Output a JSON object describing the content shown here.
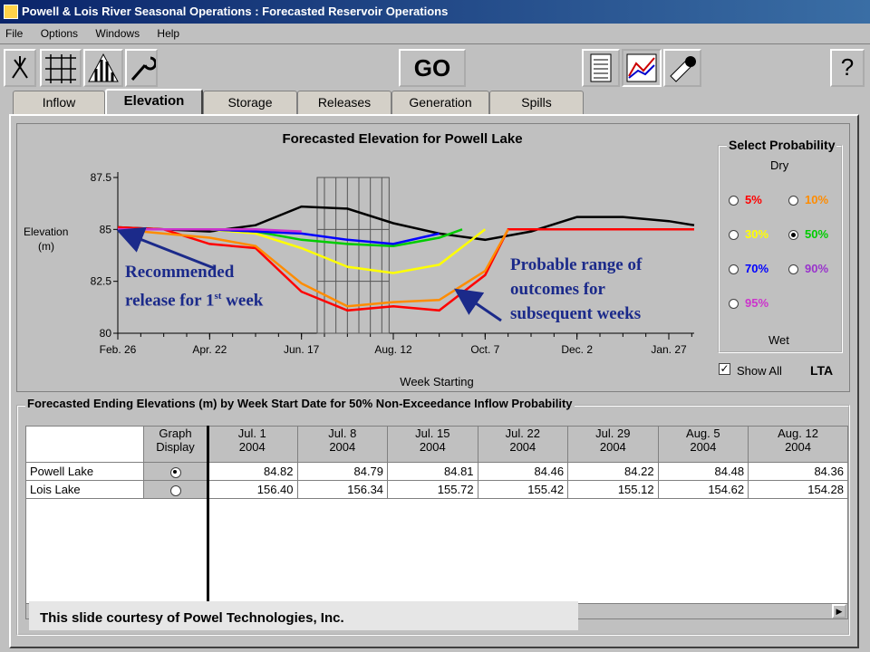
{
  "window": {
    "title": "Powell & Lois River Seasonal Operations : Forecasted Reservoir Operations"
  },
  "menu": [
    "File",
    "Options",
    "Windows",
    "Help"
  ],
  "toolbar": {
    "left_icons": [
      "y-branch-icon",
      "grid-rule-icon",
      "histogram-icon",
      "wrench-icon"
    ],
    "go_label": "GO",
    "right_icons": [
      "report-sheet-icon",
      "xy-chart-icon",
      "tools-icon"
    ],
    "help_label": "?"
  },
  "tabs": [
    "Inflow",
    "Elevation",
    "Storage",
    "Releases",
    "Generation",
    "Spills"
  ],
  "active_tab": "Elevation",
  "chart": {
    "title": "Forecasted Elevation for Powell Lake",
    "ylabel_line1": "Elevation",
    "ylabel_line2": "(m)",
    "xlabel": "Week Starting",
    "y_ticks": [
      "87.5",
      "85",
      "82.5",
      "80"
    ],
    "x_ticks": [
      "Feb. 26",
      "Apr. 22",
      "Jun. 17",
      "Aug. 12",
      "Oct. 7",
      "Dec. 2",
      "Jan. 27"
    ]
  },
  "chart_data": {
    "type": "line",
    "title": "Forecasted Elevation for Powell Lake",
    "xlabel": "Week Starting",
    "ylabel": "Elevation (m)",
    "x_tick_labels": [
      "Feb. 26",
      "Apr. 22",
      "Jun. 17",
      "Aug. 12",
      "Oct. 7",
      "Dec. 2",
      "Jan. 27"
    ],
    "ylim": [
      80,
      87.5
    ],
    "grid": false,
    "legend": "right panel (Select Probability)",
    "series": [
      {
        "name": "LTA",
        "color": "#000000",
        "x": [
          "Feb. 26",
          "Mar. 25",
          "Apr. 22",
          "May 20",
          "Jun. 17",
          "Jul. 15",
          "Aug. 12",
          "Sep. 9",
          "Oct. 7",
          "Nov. 4",
          "Dec. 2",
          "Dec. 30",
          "Jan. 27",
          "Feb. 24"
        ],
        "y": [
          85.1,
          85.0,
          84.9,
          85.2,
          86.1,
          86.0,
          85.3,
          84.8,
          84.5,
          84.9,
          85.6,
          85.6,
          85.4,
          85.2
        ]
      },
      {
        "name": "5%",
        "color": "#ff0000",
        "x": [
          "Feb. 26",
          "Mar. 25",
          "Apr. 22",
          "May 20",
          "Jun. 17",
          "Jul. 15",
          "Aug. 12",
          "Sep. 9",
          "Oct. 7",
          "Oct. 21",
          "Dec. 2",
          "Feb. 24"
        ],
        "y": [
          85.1,
          85.0,
          84.3,
          84.1,
          82.0,
          81.1,
          81.3,
          81.1,
          82.8,
          85.0,
          85.0,
          85.0
        ]
      },
      {
        "name": "10%",
        "color": "#ff8c00",
        "x": [
          "Feb. 26",
          "Apr. 22",
          "May 20",
          "Jun. 17",
          "Jul. 15",
          "Aug. 12",
          "Sep. 9",
          "Oct. 7",
          "Oct. 21"
        ],
        "y": [
          85.0,
          84.6,
          84.2,
          82.4,
          81.3,
          81.5,
          81.6,
          83.0,
          85.0
        ]
      },
      {
        "name": "30%",
        "color": "#ffff00",
        "x": [
          "Feb. 26",
          "Apr. 22",
          "May 20",
          "Jun. 17",
          "Jul. 15",
          "Aug. 12",
          "Sep. 9",
          "Oct. 7"
        ],
        "y": [
          85.0,
          85.0,
          84.8,
          84.1,
          83.2,
          82.9,
          83.3,
          85.0
        ]
      },
      {
        "name": "50%",
        "color": "#00cc00",
        "x": [
          "Feb. 26",
          "Apr. 22",
          "May 20",
          "Jun. 17",
          "Jul. 15",
          "Aug. 12",
          "Sep. 9",
          "Sep. 23"
        ],
        "y": [
          85.0,
          85.0,
          84.9,
          84.5,
          84.3,
          84.2,
          84.6,
          85.0
        ]
      },
      {
        "name": "70%",
        "color": "#0000ff",
        "x": [
          "Feb. 26",
          "Apr. 22",
          "May 20",
          "Jun. 17",
          "Jul. 15",
          "Aug. 12",
          "Sep. 9"
        ],
        "y": [
          85.0,
          85.0,
          84.9,
          84.8,
          84.5,
          84.3,
          84.8
        ]
      },
      {
        "name": "95%",
        "color": "#cc33cc",
        "x": [
          "Feb. 26",
          "Apr. 22",
          "May 20",
          "Jun. 17"
        ],
        "y": [
          85.0,
          85.0,
          85.0,
          84.9
        ]
      }
    ],
    "highlight_weeks": [
      "Jul. 1",
      "Jul. 8",
      "Jul. 15",
      "Jul. 22",
      "Jul. 29",
      "Aug. 5"
    ]
  },
  "probability": {
    "title": "Select Probability",
    "dry_label": "Dry",
    "wet_label": "Wet",
    "options": [
      {
        "label": "5%",
        "color": "#ff0000",
        "selected": false
      },
      {
        "label": "10%",
        "color": "#ff8c00",
        "selected": false
      },
      {
        "label": "30%",
        "color": "#ffff00",
        "selected": false
      },
      {
        "label": "50%",
        "color": "#00cc00",
        "selected": true
      },
      {
        "label": "70%",
        "color": "#0000ff",
        "selected": false
      },
      {
        "label": "90%",
        "color": "#9933cc",
        "selected": false
      },
      {
        "label": "95%",
        "color": "#cc33cc",
        "selected": false
      }
    ],
    "show_all_label": "Show All",
    "show_all_checked": true,
    "lta_label": "LTA"
  },
  "annotations": {
    "left_line1": "Recommended",
    "left_line2_prefix": "release for 1",
    "left_line2_sup": "st",
    "left_line2_suffix": " week",
    "right_line1": "Probable range of",
    "right_line2": "outcomes for",
    "right_line3": "subsequent weeks"
  },
  "table": {
    "title": "Forecasted Ending Elevations (m) by Week Start Date for 50% Non-Exceedance Inflow Probability",
    "graph_display_header": [
      "Graph",
      "Display"
    ],
    "columns": [
      [
        "Jul. 1",
        "2004"
      ],
      [
        "Jul. 8",
        "2004"
      ],
      [
        "Jul. 15",
        "2004"
      ],
      [
        "Jul. 22",
        "2004"
      ],
      [
        "Jul. 29",
        "2004"
      ],
      [
        "Aug. 5",
        "2004"
      ],
      [
        "Aug. 12",
        "2004"
      ]
    ],
    "rows": [
      {
        "name": "Powell Lake",
        "selected": true,
        "values": [
          "84.82",
          "84.79",
          "84.81",
          "84.46",
          "84.22",
          "84.48",
          "84.36"
        ]
      },
      {
        "name": "Lois Lake",
        "selected": false,
        "values": [
          "156.40",
          "156.34",
          "155.72",
          "155.42",
          "155.12",
          "154.62",
          "154.28"
        ]
      }
    ]
  },
  "footer": "This slide courtesy of Powel Technologies, Inc."
}
